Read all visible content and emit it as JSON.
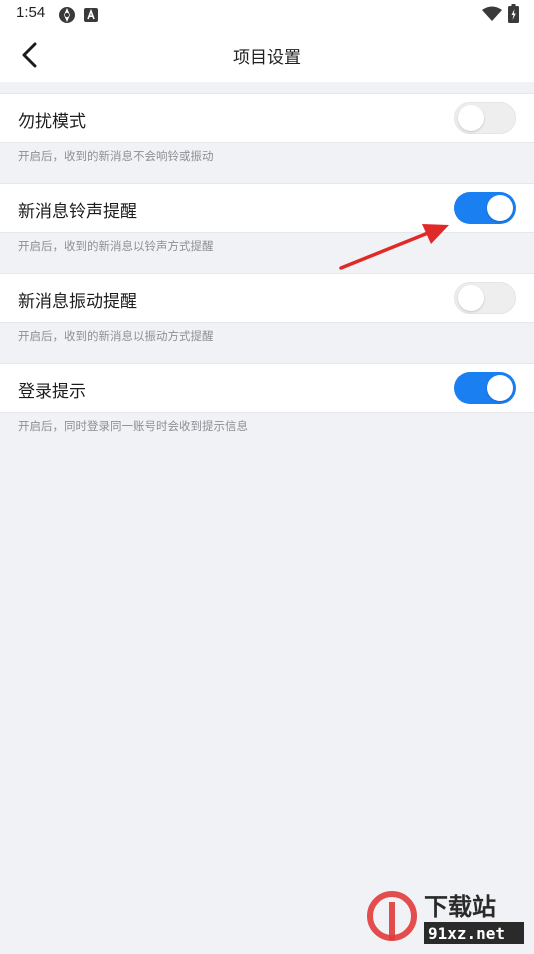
{
  "status_bar": {
    "time": "1:54",
    "icons": [
      "sync-icon",
      "keyboard-a-icon",
      "wifi-icon",
      "battery-charging-icon"
    ]
  },
  "header": {
    "title": "项目设置",
    "back_icon": "chevron-left-icon"
  },
  "settings": [
    {
      "label": "勿扰模式",
      "description": "开启后，收到的新消息不会响铃或振动",
      "enabled": false
    },
    {
      "label": "新消息铃声提醒",
      "description": "开启后，收到的新消息以铃声方式提醒",
      "enabled": true
    },
    {
      "label": "新消息振动提醒",
      "description": "开启后，收到的新消息以振动方式提醒",
      "enabled": false
    },
    {
      "label": "登录提示",
      "description": "开启后，同时登录同一账号时会收到提示信息",
      "enabled": true
    }
  ],
  "annotation": {
    "arrow_color": "#e02a2a",
    "points_to": "新消息铃声提醒"
  },
  "watermark": {
    "text_cn": "下载站",
    "text_site": "91xz.net",
    "mark_color": "#e23b3b"
  },
  "colors": {
    "toggle_on": "#1a7ff0",
    "toggle_off": "#eeeeef",
    "page_bg": "#f1f2f5"
  }
}
